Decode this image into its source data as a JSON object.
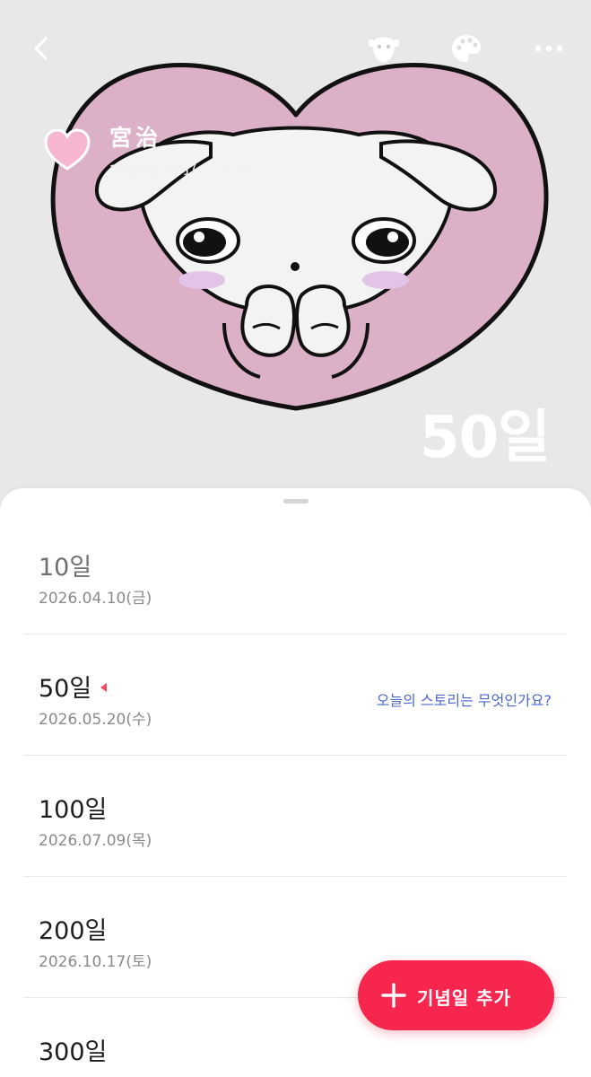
{
  "header": {
    "back_icon": "chevron-left-icon",
    "character_icon": "puppy-face-icon",
    "theme_icon": "palette-icon",
    "more_icon": "more-horizontal-icon"
  },
  "profile": {
    "heart_icon": "heart-icon",
    "name": "宮治",
    "date": "2026.04.01(수)",
    "separator": "|",
    "category": "커플"
  },
  "hero": {
    "dday": "50일",
    "colors": {
      "heart_fill": "#dcb1c8",
      "heart_outline": "#111111",
      "background": "#e8e8e9"
    }
  },
  "anniversaries": [
    {
      "title": "10일",
      "date": "2026.04.10(금)",
      "state": "past",
      "link": ""
    },
    {
      "title": "50일",
      "date": "2026.05.20(수)",
      "state": "today",
      "link": "오늘의 스토리는 무엇인가요?"
    },
    {
      "title": "100일",
      "date": "2026.07.09(목)",
      "state": "upcoming",
      "link": ""
    },
    {
      "title": "200일",
      "date": "2026.10.17(토)",
      "state": "upcoming",
      "link": ""
    },
    {
      "title": "300일",
      "date": "",
      "state": "upcoming",
      "link": ""
    }
  ],
  "fab": {
    "icon": "plus-icon",
    "label": "기념일 추가",
    "color": "#f7264e"
  },
  "colors": {
    "accent": "#f7264e",
    "link": "#4b68c9",
    "today_marker": "#f2485f"
  }
}
